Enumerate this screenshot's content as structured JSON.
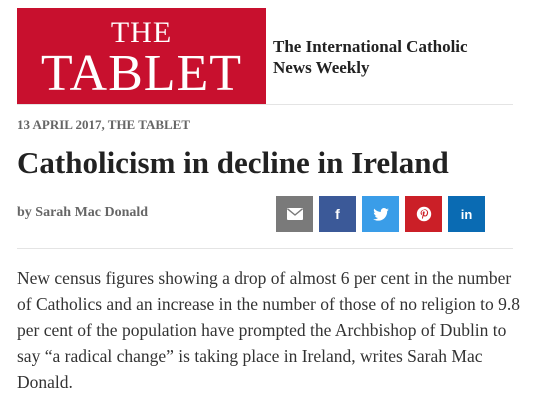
{
  "masthead": {
    "logo_line1": "THE",
    "logo_line2": "TABLET",
    "logo_color": "#c8102e",
    "tagline_line1": "The International Catholic",
    "tagline_line2": "News Weekly"
  },
  "article": {
    "dateline": "13 APRIL 2017, THE TABLET",
    "headline": "Catholicism in decline in Ireland",
    "byline": "by Sarah Mac Donald",
    "intro": "New census figures showing a drop of almost 6 per cent in the number of Catholics and an increase in the number of those of no religion to 9.8 per cent of the population have prompted the Archbishop of Dublin to say “a radical change” is taking place in Ireland, writes Sarah Mac Donald."
  },
  "share_buttons": [
    {
      "network": "email",
      "icon": "envelope-icon",
      "glyph": "",
      "color": "#7a7a7a"
    },
    {
      "network": "facebook",
      "icon": "facebook-icon",
      "glyph": "f",
      "color": "#3b5998"
    },
    {
      "network": "twitter",
      "icon": "twitter-icon",
      "glyph": "",
      "color": "#3a9de8"
    },
    {
      "network": "pinterest",
      "icon": "pinterest-icon",
      "glyph": "",
      "color": "#cb1f27"
    },
    {
      "network": "linkedin",
      "icon": "linkedin-icon",
      "glyph": "in",
      "color": "#0a6bb3"
    }
  ]
}
